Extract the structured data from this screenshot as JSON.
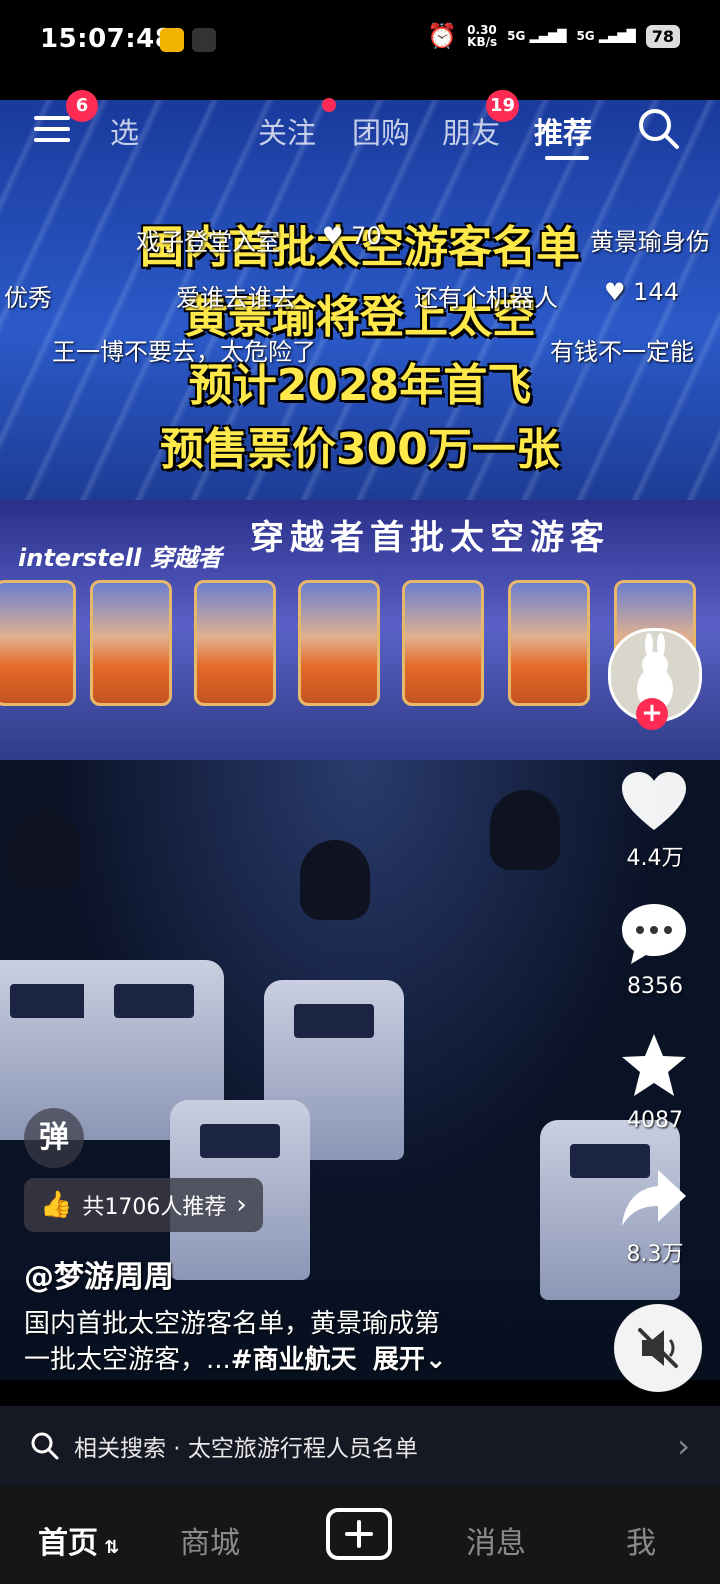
{
  "status": {
    "time": "15:07:48",
    "speed_top": "0.30",
    "speed_unit": "KB/s",
    "net1": "5G",
    "net2": "5G",
    "battery": "78"
  },
  "topnav": {
    "menu_badge": "6",
    "tab_partial": "选",
    "tabs": [
      "关注",
      "团购",
      "朋友",
      "推荐"
    ],
    "friends_badge": "19",
    "active_tab": "推荐"
  },
  "captions": [
    "国内首批太空游客名单",
    "黄景瑜将登上太空",
    "预计2028年首飞",
    "预售票价300万一张"
  ],
  "danmu": [
    {
      "text": "戏子登堂入室"
    },
    {
      "text": "70"
    },
    {
      "text": "黄景瑜身伤"
    },
    {
      "text": "优秀"
    },
    {
      "text": "爱谁去谁去"
    },
    {
      "text": "还有个机器人"
    },
    {
      "text": "144"
    },
    {
      "text": "王一博不要去，太危险了"
    },
    {
      "text": "有钱不一定能"
    }
  ],
  "scene": {
    "banner_title": "穿越者首批太空游客",
    "banner_logo": "interstell 穿越者"
  },
  "actions": {
    "likes": "4.4万",
    "comments": "8356",
    "favorites": "4087",
    "shares": "8.3万"
  },
  "danmu_button": "弹",
  "recommend": {
    "text": "共1706人推荐"
  },
  "author": "@梦游周周",
  "description": {
    "line1": "国内首批太空游客名单，黄景瑜成第",
    "line2": "一批太空游客，...",
    "hashtag": "#商业航天",
    "expand": "展开"
  },
  "related_search": {
    "text": "相关搜索 · 太空旅游行程人员名单"
  },
  "bottom_nav": {
    "home": "首页",
    "mall": "商城",
    "messages": "消息",
    "me": "我"
  }
}
